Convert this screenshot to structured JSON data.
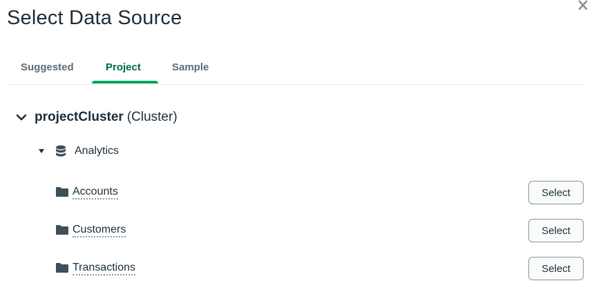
{
  "dialog": {
    "title": "Select Data Source",
    "close_icon": "close-icon"
  },
  "tabs": [
    {
      "label": "Suggested",
      "active": false
    },
    {
      "label": "Project",
      "active": true
    },
    {
      "label": "Sample",
      "active": false
    }
  ],
  "colors": {
    "accent": "#00684a",
    "accent_underline": "#00a35c",
    "text": "#1c2d38",
    "muted": "#5c6c75"
  },
  "cluster": {
    "name": "projectCluster",
    "type": "(Cluster)",
    "expanded": true,
    "database": {
      "name": "Analytics",
      "expanded": true,
      "collections": [
        {
          "name": "Accounts",
          "action": "Select"
        },
        {
          "name": "Customers",
          "action": "Select"
        },
        {
          "name": "Transactions",
          "action": "Select"
        }
      ]
    }
  }
}
